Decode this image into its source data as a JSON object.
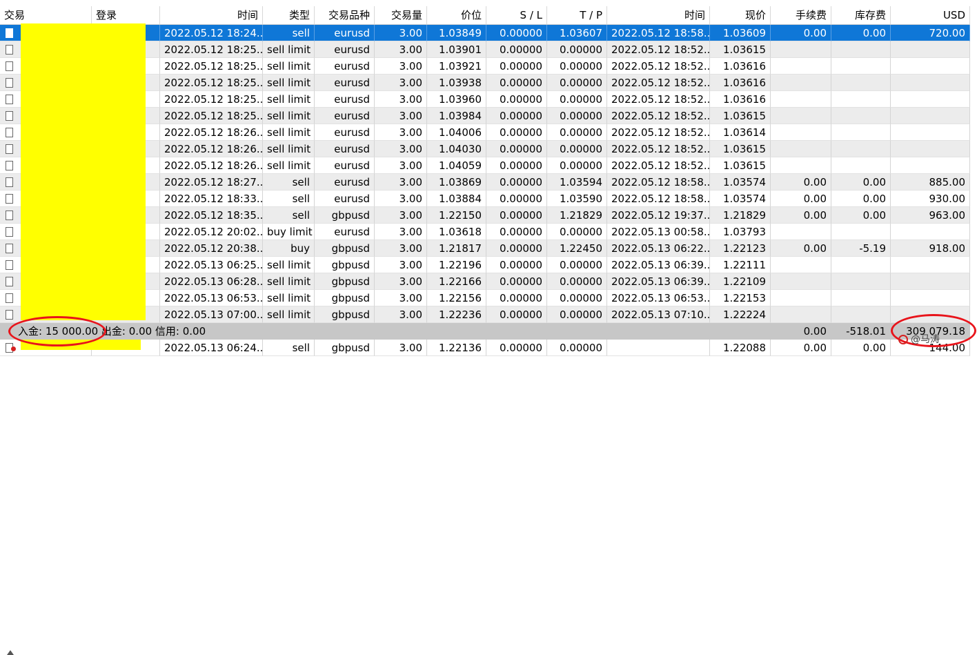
{
  "columns": [
    {
      "label": "交易",
      "w": 133,
      "align": "l"
    },
    {
      "label": "登录",
      "w": 99,
      "align": "l"
    },
    {
      "label": "时间",
      "w": 149,
      "align": "r"
    },
    {
      "label": "类型",
      "w": 75,
      "align": "r"
    },
    {
      "label": "交易品种",
      "w": 87,
      "align": "r"
    },
    {
      "label": "交易量",
      "w": 76,
      "align": "r"
    },
    {
      "label": "价位",
      "w": 86,
      "align": "r"
    },
    {
      "label": "S / L",
      "w": 88,
      "align": "r"
    },
    {
      "label": "T / P",
      "w": 87,
      "align": "r"
    },
    {
      "label": "时间",
      "w": 149,
      "align": "r"
    },
    {
      "label": "现价",
      "w": 88,
      "align": "r"
    },
    {
      "label": "手续费",
      "w": 88,
      "align": "r"
    },
    {
      "label": "库存费",
      "w": 86,
      "align": "r"
    },
    {
      "label": "USD",
      "w": 115,
      "align": "r"
    }
  ],
  "rows": [
    [
      "",
      "",
      "2022.05.12 18:24...",
      "sell",
      "eurusd",
      "3.00",
      "1.03849",
      "0.00000",
      "1.03607",
      "2022.05.12 18:58...",
      "1.03609",
      "0.00",
      "0.00",
      "720.00"
    ],
    [
      "",
      "",
      "2022.05.12 18:25...",
      "sell limit",
      "eurusd",
      "3.00",
      "1.03901",
      "0.00000",
      "0.00000",
      "2022.05.12 18:52...",
      "1.03615",
      "",
      "",
      ""
    ],
    [
      "",
      "",
      "2022.05.12 18:25...",
      "sell limit",
      "eurusd",
      "3.00",
      "1.03921",
      "0.00000",
      "0.00000",
      "2022.05.12 18:52...",
      "1.03616",
      "",
      "",
      ""
    ],
    [
      "",
      "",
      "2022.05.12 18:25...",
      "sell limit",
      "eurusd",
      "3.00",
      "1.03938",
      "0.00000",
      "0.00000",
      "2022.05.12 18:52...",
      "1.03616",
      "",
      "",
      ""
    ],
    [
      "",
      "",
      "2022.05.12 18:25...",
      "sell limit",
      "eurusd",
      "3.00",
      "1.03960",
      "0.00000",
      "0.00000",
      "2022.05.12 18:52...",
      "1.03616",
      "",
      "",
      ""
    ],
    [
      "",
      "",
      "2022.05.12 18:25...",
      "sell limit",
      "eurusd",
      "3.00",
      "1.03984",
      "0.00000",
      "0.00000",
      "2022.05.12 18:52...",
      "1.03615",
      "",
      "",
      ""
    ],
    [
      "",
      "",
      "2022.05.12 18:26...",
      "sell limit",
      "eurusd",
      "3.00",
      "1.04006",
      "0.00000",
      "0.00000",
      "2022.05.12 18:52...",
      "1.03614",
      "",
      "",
      ""
    ],
    [
      "",
      "",
      "2022.05.12 18:26...",
      "sell limit",
      "eurusd",
      "3.00",
      "1.04030",
      "0.00000",
      "0.00000",
      "2022.05.12 18:52...",
      "1.03615",
      "",
      "",
      ""
    ],
    [
      "",
      "",
      "2022.05.12 18:26...",
      "sell limit",
      "eurusd",
      "3.00",
      "1.04059",
      "0.00000",
      "0.00000",
      "2022.05.12 18:52...",
      "1.03615",
      "",
      "",
      ""
    ],
    [
      "",
      "",
      "2022.05.12 18:27...",
      "sell",
      "eurusd",
      "3.00",
      "1.03869",
      "0.00000",
      "1.03594",
      "2022.05.12 18:58...",
      "1.03574",
      "0.00",
      "0.00",
      "885.00"
    ],
    [
      "",
      "",
      "2022.05.12 18:33...",
      "sell",
      "eurusd",
      "3.00",
      "1.03884",
      "0.00000",
      "1.03590",
      "2022.05.12 18:58...",
      "1.03574",
      "0.00",
      "0.00",
      "930.00"
    ],
    [
      "",
      "",
      "2022.05.12 18:35...",
      "sell",
      "gbpusd",
      "3.00",
      "1.22150",
      "0.00000",
      "1.21829",
      "2022.05.12 19:37...",
      "1.21829",
      "0.00",
      "0.00",
      "963.00"
    ],
    [
      "",
      "",
      "2022.05.12 20:02...",
      "buy limit",
      "eurusd",
      "3.00",
      "1.03618",
      "0.00000",
      "0.00000",
      "2022.05.13 00:58...",
      "1.03793",
      "",
      "",
      ""
    ],
    [
      "",
      "",
      "2022.05.12 20:38...",
      "buy",
      "gbpusd",
      "3.00",
      "1.21817",
      "0.00000",
      "1.22450",
      "2022.05.13 06:22...",
      "1.22123",
      "0.00",
      "-5.19",
      "918.00"
    ],
    [
      "",
      "",
      "2022.05.13 06:25...",
      "sell limit",
      "gbpusd",
      "3.00",
      "1.22196",
      "0.00000",
      "0.00000",
      "2022.05.13 06:39...",
      "1.22111",
      "",
      "",
      ""
    ],
    [
      "",
      "",
      "2022.05.13 06:28...",
      "sell limit",
      "gbpusd",
      "3.00",
      "1.22166",
      "0.00000",
      "0.00000",
      "2022.05.13 06:39...",
      "1.22109",
      "",
      "",
      ""
    ],
    [
      "",
      "",
      "2022.05.13 06:53...",
      "sell limit",
      "gbpusd",
      "3.00",
      "1.22156",
      "0.00000",
      "0.00000",
      "2022.05.13 06:53...",
      "1.22153",
      "",
      "",
      ""
    ],
    [
      "",
      "",
      "2022.05.13 07:00...",
      "sell limit",
      "gbpusd",
      "3.00",
      "1.22236",
      "0.00000",
      "0.00000",
      "2022.05.13 07:10...",
      "1.22224",
      "",
      "",
      ""
    ]
  ],
  "selected_row": 0,
  "summary": {
    "text": "入金: 15 000.00  出金: 0.00  信用: 0.00",
    "commission": "0.00",
    "swap": "-518.01",
    "total": "309 079.18"
  },
  "last_row": [
    "",
    "",
    "2022.05.13 06:24...",
    "sell",
    "gbpusd",
    "3.00",
    "1.22136",
    "0.00000",
    "0.00000",
    "",
    "1.22088",
    "0.00",
    "0.00",
    "144.00"
  ],
  "watermark": "@马涛",
  "colors": {
    "selection": "#0f77d7",
    "redaction": "#ffff00",
    "annotation_circle": "#e8141b"
  }
}
